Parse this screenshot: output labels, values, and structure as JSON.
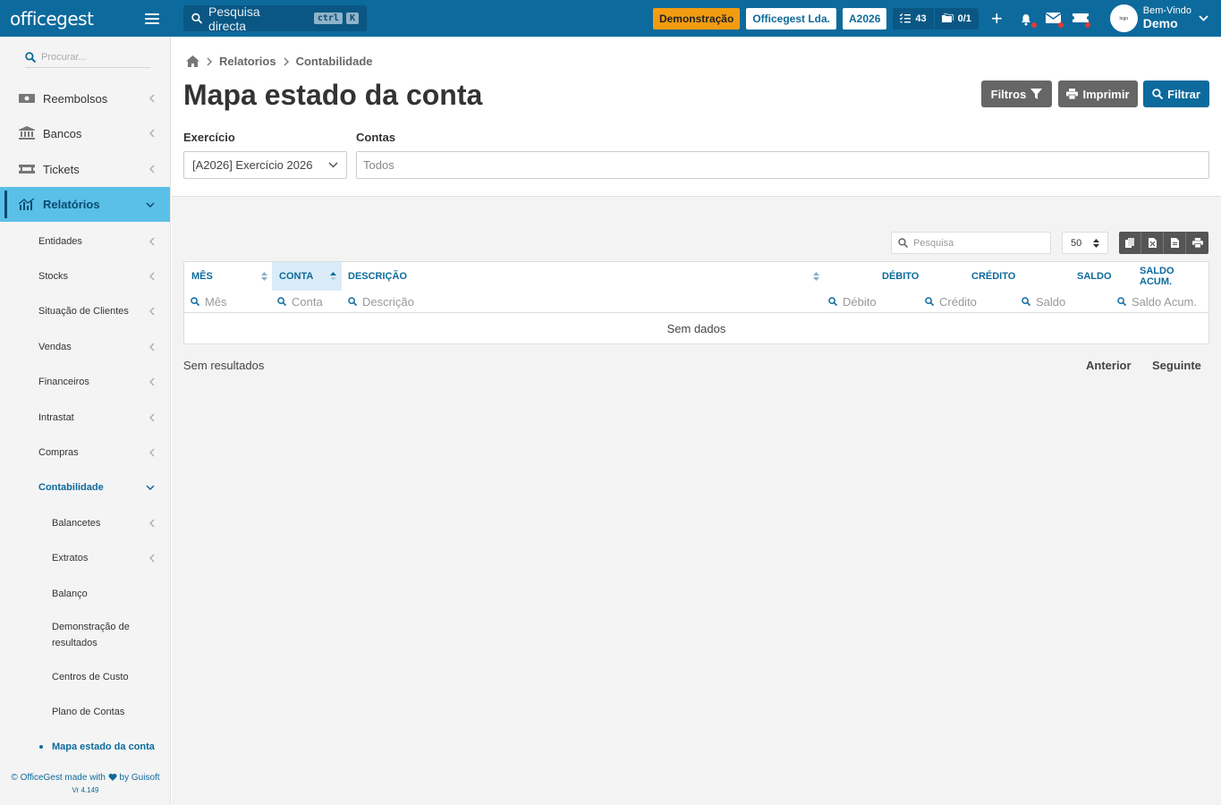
{
  "topbar": {
    "logo": "officegest",
    "search_placeholder": "Pesquisa directa",
    "shortcut_keys": [
      "ctrl",
      "K"
    ],
    "badge_demo": "Demonstração",
    "company": "Officegest Lda.",
    "year": "A2026",
    "tasks_count": "43",
    "docs_count": "0/1",
    "user_greeting": "Bem-Vindo",
    "user_name": "Demo",
    "colors": {
      "bar": "#0d6a9c",
      "demo_badge": "#f39c12"
    }
  },
  "sidebar": {
    "search_placeholder": "Procurar...",
    "items": [
      {
        "label": "Reembolsos",
        "icon": "money-icon"
      },
      {
        "label": "Bancos",
        "icon": "bank-icon"
      },
      {
        "label": "Tickets",
        "icon": "ticket-icon"
      },
      {
        "label": "Relatórios",
        "icon": "chart-icon",
        "active": true
      }
    ],
    "sub_items": [
      "Entidades",
      "Stocks",
      "Situação de Clientes",
      "Vendas",
      "Financeiros",
      "Intrastat",
      "Compras",
      "Contabilidade"
    ],
    "contabilidade_items": [
      "Balancetes",
      "Extratos",
      "Balanço",
      "Demonstração de resultados",
      "Centros de Custo",
      "Plano de Contas",
      "Mapa estado da conta"
    ],
    "footer_line1": "© OfficeGest made with",
    "footer_by": "by Guisoft",
    "version": "Vr 4.149"
  },
  "main": {
    "breadcrumb": [
      "Relatorios",
      "Contabilidade"
    ],
    "title": "Mapa estado da conta",
    "buttons": {
      "filters": "Filtros",
      "print": "Imprimir",
      "filter": "Filtrar"
    },
    "exercicio_label": "Exercício",
    "exercicio_value": "[A2026] Exercício 2026",
    "contas_label": "Contas",
    "contas_placeholder": "Todos"
  },
  "table": {
    "search_placeholder": "Pesquisa",
    "page_size": "50",
    "columns": [
      "MÊS",
      "CONTA",
      "DESCRIÇÃO",
      "DÉBITO",
      "CRÉDITO",
      "SALDO",
      "SALDO ACUM."
    ],
    "filters": [
      "Mês",
      "Conta",
      "Descrição",
      "Débito",
      "Crédito",
      "Saldo",
      "Saldo Acum."
    ],
    "empty_text": "Sem dados",
    "results_text": "Sem resultados",
    "prev": "Anterior",
    "next": "Seguinte"
  }
}
